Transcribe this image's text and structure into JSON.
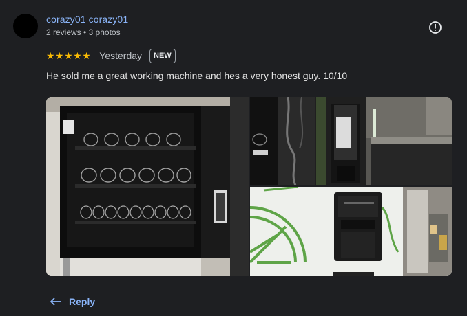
{
  "author": {
    "name": "corazy01 corazy01",
    "meta": "2 reviews • 3 photos"
  },
  "review": {
    "stars": "★★★★★",
    "rating": 5,
    "time": "Yesterday",
    "badge": "NEW",
    "text": "He sold me a great working machine and hes a very honest guy. 10/10"
  },
  "actions": {
    "reply_label": "Reply",
    "report_icon": "alert-circle-icon",
    "reply_icon": "reply-arrow-icon"
  },
  "colors": {
    "background": "#1e1f22",
    "link": "#8ab4f8",
    "star": "#fbbc04",
    "text": "#e3e3e3",
    "muted": "#bdc1c6"
  }
}
